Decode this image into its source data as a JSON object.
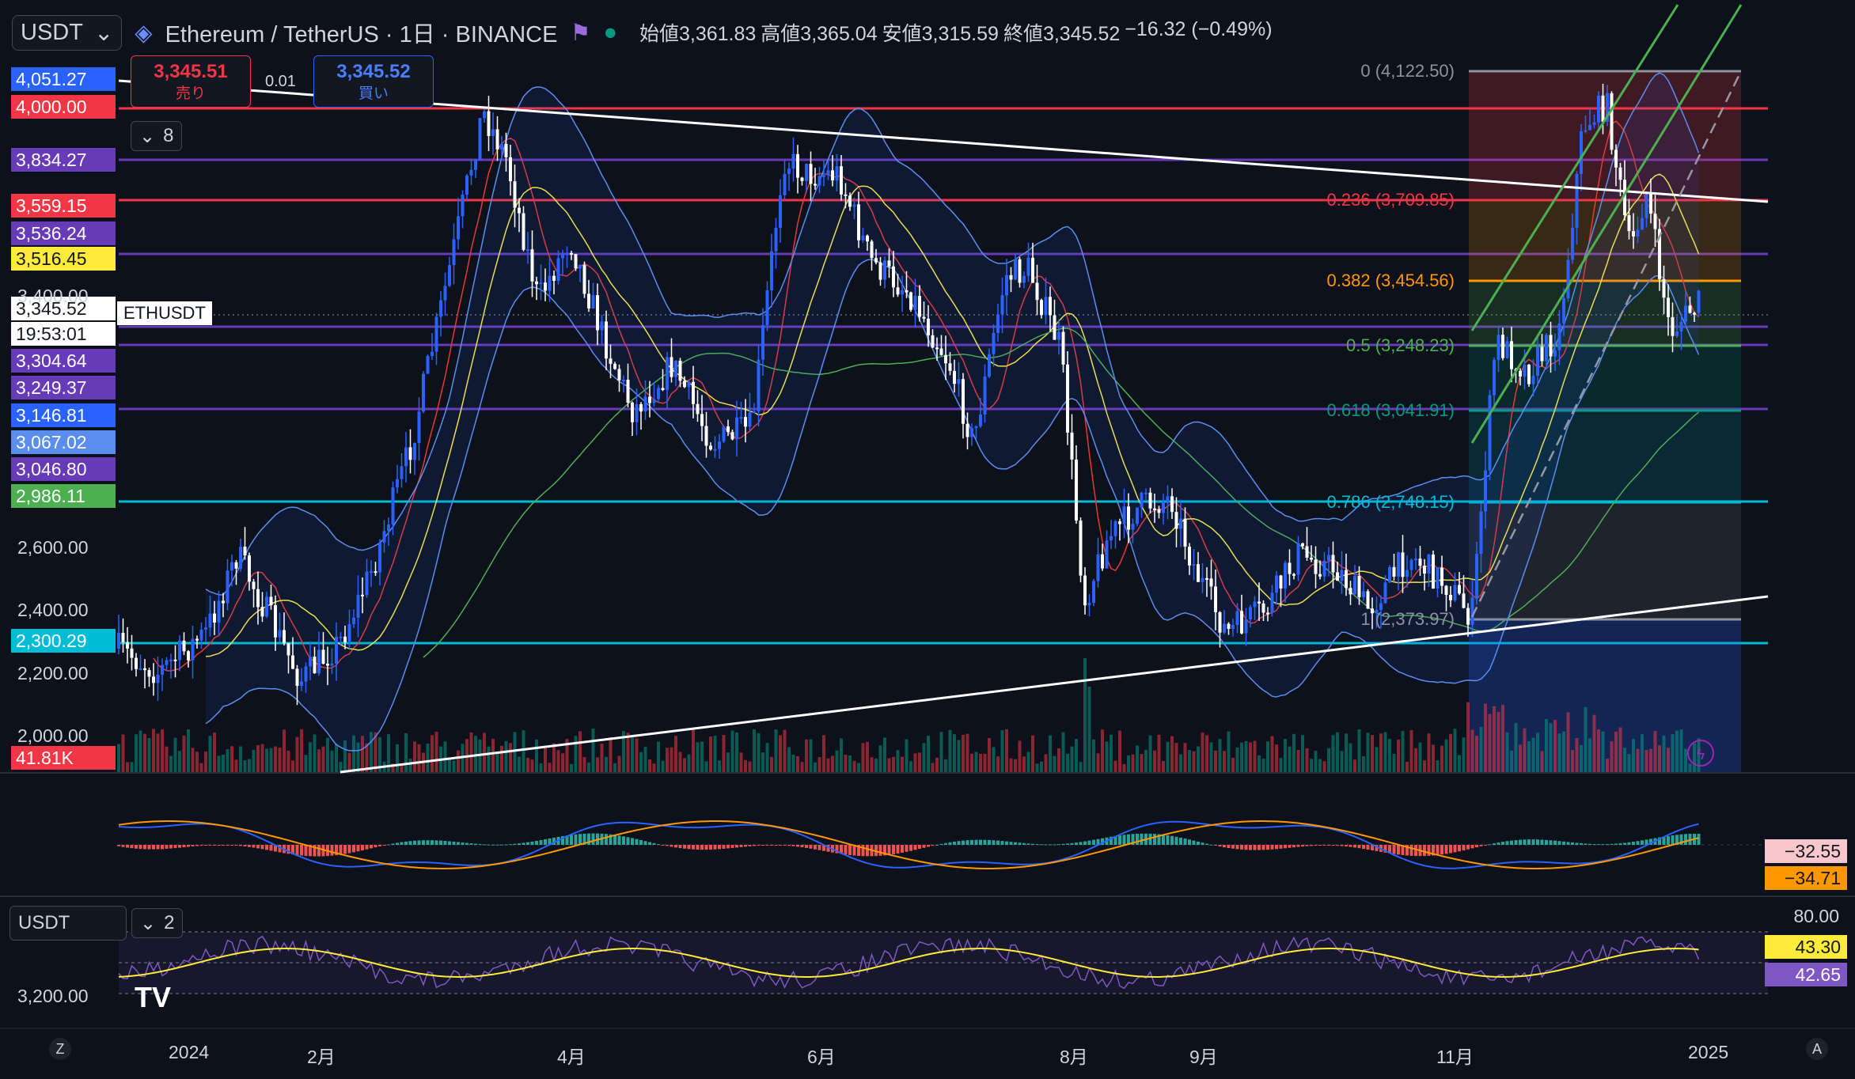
{
  "header": {
    "currency": "USDT",
    "title": "Ethereum / TetherUS · 1日 · BINANCE",
    "ohlc": [
      "始値3,361.83",
      "高値3,365.04",
      "安値3,315.59",
      "終値3,345.52",
      "−16.32 (−0.49%)"
    ]
  },
  "order": {
    "sell_price": "3,345.51",
    "sell_label": "売り",
    "buy_price": "3,345.52",
    "buy_label": "買い",
    "spread": "0.01"
  },
  "indicator_badge": "8",
  "symbol_label": "ETHUSDT",
  "price_labels": [
    {
      "text": "4,051.27",
      "color": "#2962ff"
    },
    {
      "text": "4,000.00",
      "color": "#f23645"
    },
    {
      "text": "3,834.27",
      "color": "#673ab7"
    },
    {
      "text": "3,559.15",
      "color": "#f23645"
    },
    {
      "text": "3,536.24",
      "color": "#673ab7"
    },
    {
      "text": "3,516.45",
      "color": "#ffeb3b"
    },
    {
      "text": "3,345.52",
      "color": "#ffffff"
    },
    {
      "text": "19:53:01",
      "color": "#ffffff"
    },
    {
      "text": "3,304.64",
      "color": "#673ab7"
    },
    {
      "text": "3,249.37",
      "color": "#673ab7"
    },
    {
      "text": "3,146.81",
      "color": "#2962ff"
    },
    {
      "text": "3,067.02",
      "color": "#5b8def"
    },
    {
      "text": "3,046.80",
      "color": "#673ab7"
    },
    {
      "text": "2,986.11",
      "color": "#4caf50"
    },
    {
      "text": "2,300.29",
      "color": "#00bcd4"
    },
    {
      "text": "41.81K",
      "color": "#f23645"
    }
  ],
  "axis_labels": [
    "3,400.00",
    "2,600.00",
    "2,400.00",
    "2,200.00",
    "2,000.00"
  ],
  "fib_levels": [
    {
      "text": "0 (4,122.50)",
      "color": "#8f929c"
    },
    {
      "text": "0.236 (3,709.85)",
      "color": "#f23645"
    },
    {
      "text": "0.382 (3,454.56)",
      "color": "#ff9800"
    },
    {
      "text": "0.5 (3,248.23)",
      "color": "#4caf50"
    },
    {
      "text": "0.618 (3,041.91)",
      "color": "#089981"
    },
    {
      "text": "0.786 (2,748.15)",
      "color": "#00bcd4"
    },
    {
      "text": "1 (2,373.97)",
      "color": "#8f929c"
    }
  ],
  "macd_labels": [
    "−32.55",
    "−34.71"
  ],
  "rsi": {
    "currency": "USDT",
    "badge": "2",
    "axis_left": "3,200.00",
    "axis_right": "80.00",
    "labels": [
      "43.30",
      "42.65"
    ]
  },
  "x_labels": [
    "2024",
    "2月",
    "4月",
    "6月",
    "8月",
    "9月",
    "11月",
    "2025"
  ],
  "corner": {
    "left": "Z",
    "right": "A"
  }
}
